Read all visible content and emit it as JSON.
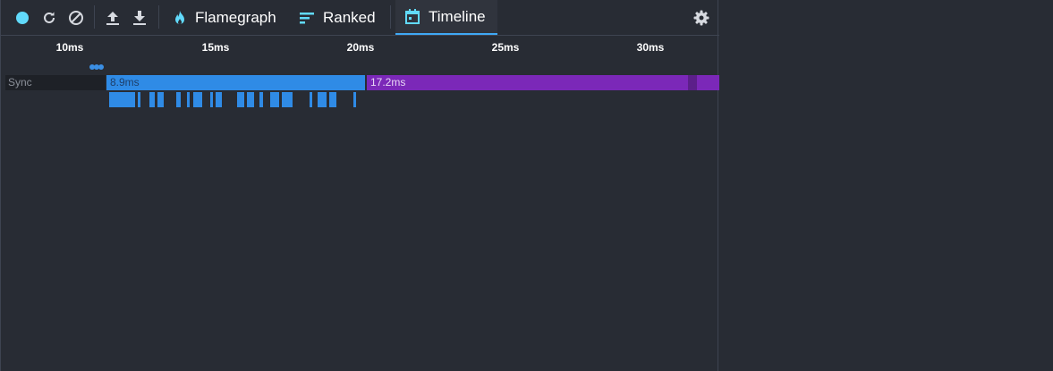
{
  "toolbar": {
    "record_icon": "record-dot-icon",
    "reload_icon": "reload-icon",
    "clear_icon": "clear-icon",
    "upload_icon": "upload-icon",
    "download_icon": "download-icon",
    "settings_icon": "gear-icon",
    "tabs": [
      {
        "label": "Flamegraph",
        "icon": "flame-icon",
        "active": false
      },
      {
        "label": "Ranked",
        "icon": "ranked-icon",
        "active": false
      },
      {
        "label": "Timeline",
        "icon": "calendar-icon",
        "active": true
      }
    ]
  },
  "timeline": {
    "ticks": [
      "10ms",
      "15ms",
      "20ms",
      "25ms",
      "30ms"
    ],
    "lane_label": "Sync",
    "bars": [
      {
        "label": "8.9ms",
        "color": "#2f8be6"
      },
      {
        "label": "17.2ms",
        "color": "#7b28b8"
      }
    ]
  },
  "colors": {
    "background": "#282c34",
    "accent": "#3fa9f5",
    "render_blue": "#2f8be6",
    "commit_purple": "#7b28b8"
  }
}
